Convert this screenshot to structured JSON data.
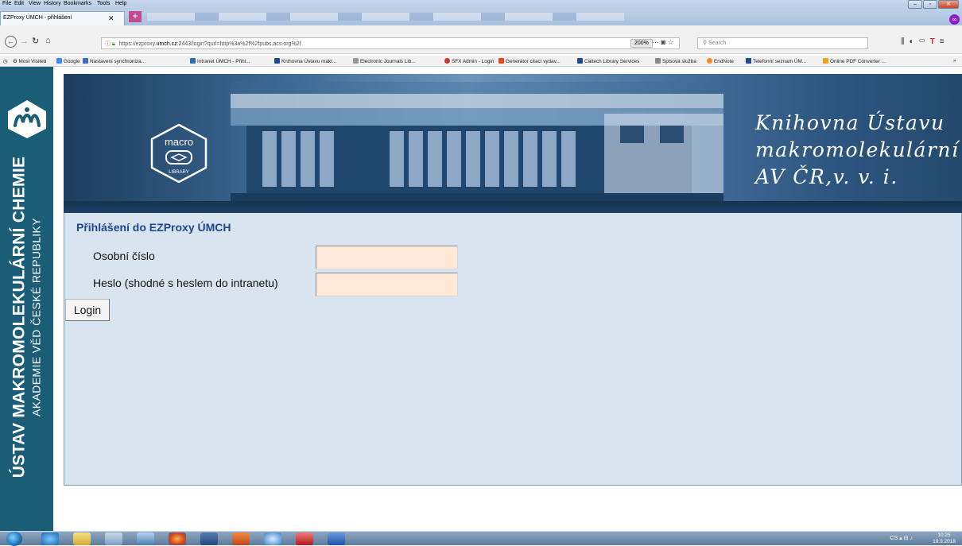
{
  "browser": {
    "menu": [
      "File",
      "Edit",
      "View",
      "History",
      "Bookmarks",
      "Tools",
      "Help"
    ],
    "tab_title": "EZProxy ÚMCH - přihlášení",
    "url_prefix": "https://ezproxy.",
    "url_domain": "umch.cz",
    "url_rest": ":2443/login?qurl=http%3a%2f%2fpubs.acs.org%2f",
    "zoom": "200%",
    "search_placeholder": "Search",
    "bookmarks": [
      {
        "label": "Most Visited",
        "color": "#777777"
      },
      {
        "label": "Google",
        "color": "#4285f4"
      },
      {
        "label": "Nastavení synchroniza...",
        "color": "#3d6fb6"
      },
      {
        "label": "Intranet ÚMCH - Přihl...",
        "color": "#2a6fb0"
      },
      {
        "label": "Knihovna Ústavu makr...",
        "color": "#1f4d8c"
      },
      {
        "label": "Electronic Journals Lib...",
        "color": "#999999"
      },
      {
        "label": "SFX Admin - Login",
        "color": "#c0392b"
      },
      {
        "label": "Generátor citací vydav...",
        "color": "#e04a1d"
      },
      {
        "label": "Caltech Library Services",
        "color": "#1a4b8c"
      },
      {
        "label": "Spisová služba",
        "color": "#888888"
      },
      {
        "label": "EndNote",
        "color": "#f08a24"
      },
      {
        "label": "Telefonní seznam ÚM...",
        "color": "#1f4d8c"
      },
      {
        "label": "Online PDF Converter ...",
        "color": "#f0a020"
      }
    ]
  },
  "sidebar": {
    "line1": "ÚSTAV MAKROMOLEKULÁRNÍ CHEMIE",
    "line2": "AKADEMIE VĚD ČESKÉ REPUBLIKY"
  },
  "banner": {
    "logo_top": "macro",
    "logo_bottom": "LIBRARY",
    "title_lines": [
      "Knihovna Ústavu",
      "makromolekulární ch",
      "AV ČR,v. v. i."
    ]
  },
  "login": {
    "title": "Přihlášení do EZProxy ÚMCH",
    "username_label": "Osobní číslo",
    "password_label": "Heslo (shodné s heslem do intranetu)",
    "username_value": "",
    "password_value": "",
    "button_label": "Login"
  },
  "taskbar": {
    "language": "CS",
    "time": "10:25",
    "date": "19.9.2018"
  }
}
